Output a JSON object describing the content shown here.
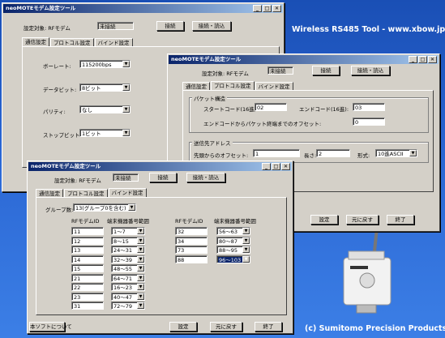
{
  "brand": "Wireless RS485 Tool - www.xbow.jp",
  "copyright": "(c) Sumitomo Precision Products",
  "colors": {
    "background": "#2a66d3",
    "titlebar": "#0a246a",
    "window": "#d4d0c8"
  },
  "win1": {
    "title": "neoMOTEモデム設定ツール",
    "target_label": "設定対象: RFモデム",
    "target_status": "未接続",
    "connect": "接続",
    "connect_read": "接続・読込",
    "tabs": [
      "通信設定",
      "プロトコル設定",
      "バインド設定"
    ],
    "baud_label": "ボーレート:",
    "baud_value": "115200bps",
    "databit_label": "データビット:",
    "databit_value": "8ビット",
    "parity_label": "パリティ:",
    "parity_value": "なし",
    "stopbit_label": "ストップビット:",
    "stopbit_value": "1ビット",
    "about": "本ソフトについて"
  },
  "win2": {
    "title": "neoMOTEモデム設定ツール",
    "target_label": "設定対象: RFモデム",
    "target_status": "未接続",
    "connect": "接続",
    "connect_read": "接続・読込",
    "tabs": [
      "通信設定",
      "プロトコル設定",
      "バインド設定"
    ],
    "packet_group": "パケット構造",
    "start_code_label": "スタートコード(16進):",
    "start_code": "02",
    "end_code_label": "エンドコード(16進):",
    "end_code": "03",
    "offset_label": "エンドコードからパケット終端までのオフセット:",
    "offset": "0",
    "dest_group": "送信先アドレス",
    "head_offset_label": "先頭からのオフセット:",
    "head_offset": "1",
    "length_label": "長さ:",
    "length": "2",
    "format_label": "形式:",
    "format": "10進ASCII",
    "set": "設定",
    "restore": "元に戻す",
    "exit": "終了"
  },
  "win3": {
    "title": "neoMOTEモデム設定ツール",
    "target_label": "設定対象: RFモデム",
    "target_status": "未接続",
    "connect": "接続",
    "connect_read": "接続・読込",
    "tabs": [
      "通信設定",
      "プロトコル設定",
      "バインド設定"
    ],
    "group_label": "グループ数:",
    "group_value": "13(グループ0を含む)",
    "col_rf": "RFモデムID",
    "col_range": "端末機器番号範囲",
    "left_rows": [
      {
        "id": "11",
        "range": "1～7"
      },
      {
        "id": "12",
        "range": "8～15"
      },
      {
        "id": "13",
        "range": "24～31"
      },
      {
        "id": "14",
        "range": "32～39"
      },
      {
        "id": "15",
        "range": "48～55"
      },
      {
        "id": "21",
        "range": "64～71"
      },
      {
        "id": "22",
        "range": "16～23"
      },
      {
        "id": "23",
        "range": "40～47"
      },
      {
        "id": "31",
        "range": "72～79"
      }
    ],
    "right_rows": [
      {
        "id": "32",
        "range": "56～63"
      },
      {
        "id": "34",
        "range": "80～87"
      },
      {
        "id": "73",
        "range": "88～95"
      },
      {
        "id": "88",
        "range": "96～103"
      }
    ],
    "about": "本ソフトについて",
    "set": "設定",
    "restore": "元に戻す",
    "exit": "終了"
  }
}
